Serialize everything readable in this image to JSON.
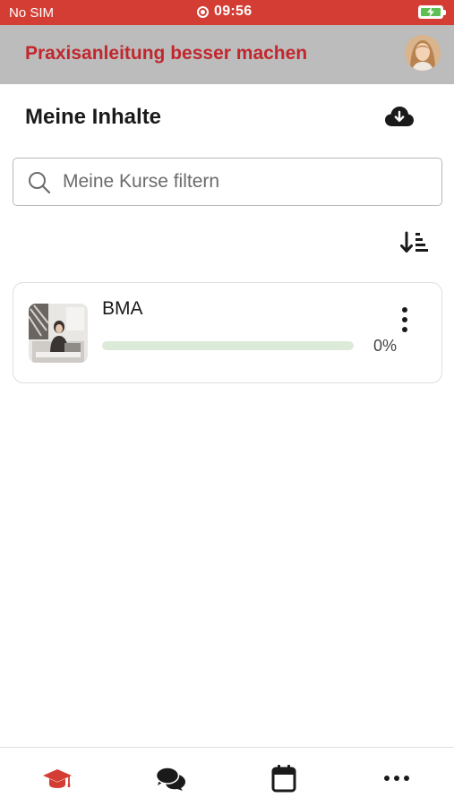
{
  "status_bar": {
    "carrier": "No SIM",
    "time": "09:56"
  },
  "header": {
    "title": "Praxisanleitung besser machen",
    "title_color": "#c1272d",
    "background": "#bcbcbc"
  },
  "content": {
    "section_title": "Meine Inhalte",
    "download_icon": "cloud-download-icon",
    "sort_icon": "sort-descending-icon"
  },
  "search": {
    "placeholder": "Meine Kurse filtern",
    "value": ""
  },
  "courses": [
    {
      "title": "BMA",
      "progress_percent": 0,
      "progress_label": "0%"
    }
  ],
  "bottom_nav": {
    "items": [
      {
        "icon": "graduation-cap-icon",
        "active": true,
        "color": "#d43d34"
      },
      {
        "icon": "chat-bubbles-icon",
        "active": false
      },
      {
        "icon": "calendar-icon",
        "active": false
      },
      {
        "icon": "more-horizontal-icon",
        "active": false
      }
    ]
  },
  "colors": {
    "status_bar": "#d43d34",
    "progress_track": "#dcead8",
    "progress_fill": "#6bb35f"
  }
}
